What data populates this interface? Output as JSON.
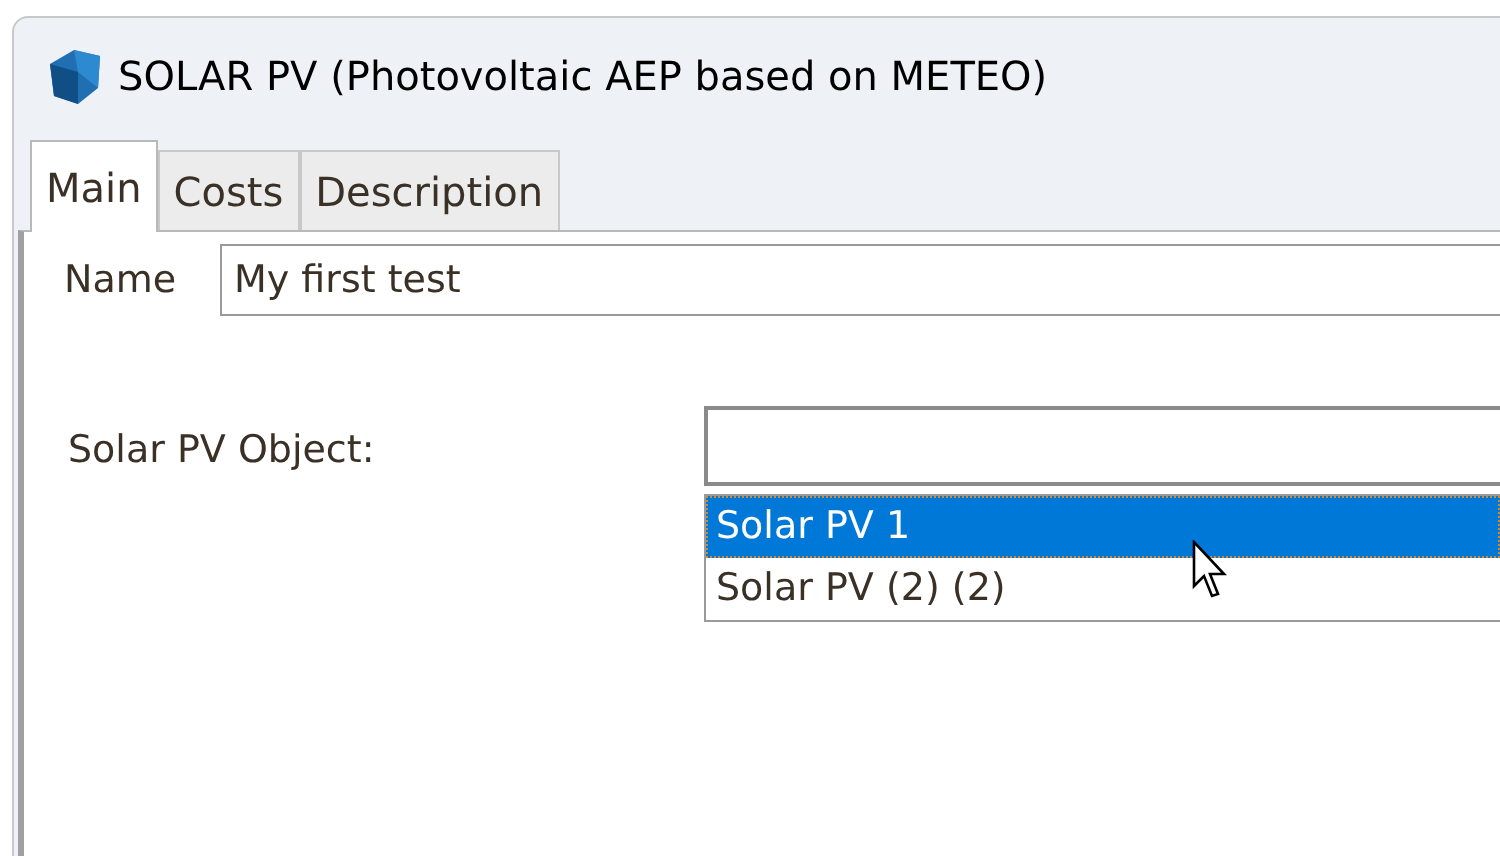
{
  "window": {
    "title": "SOLAR PV (Photovoltaic AEP based on METEO)"
  },
  "tabs": [
    {
      "label": "Main",
      "selected": true
    },
    {
      "label": "Costs",
      "selected": false
    },
    {
      "label": "Description",
      "selected": false
    }
  ],
  "name_field": {
    "label": "Name",
    "value": "My first test"
  },
  "object_field": {
    "label": "Solar PV Object:",
    "options": [
      {
        "label": "Solar PV 1",
        "selected": true
      },
      {
        "label": "Solar PV (2) (2)",
        "selected": false
      }
    ]
  }
}
